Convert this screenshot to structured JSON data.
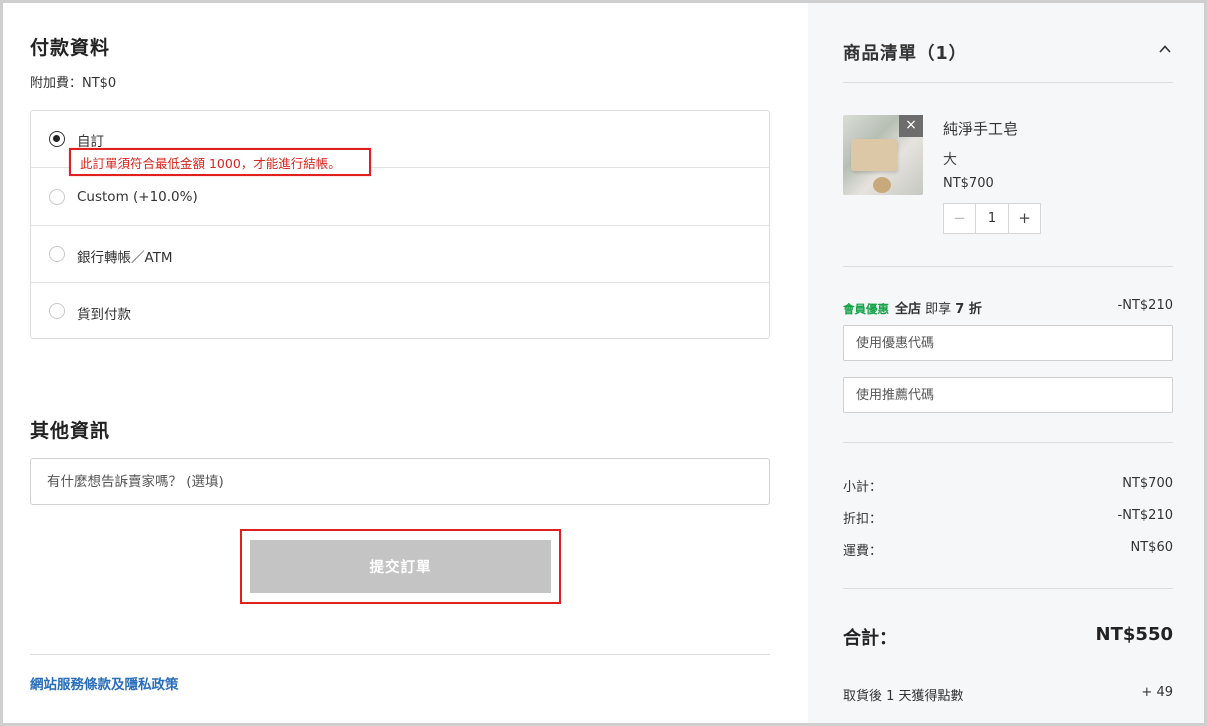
{
  "payment": {
    "title": "付款資料",
    "surcharge": "附加費：NT$0",
    "options": [
      {
        "label": "自訂",
        "selected": true
      },
      {
        "label": "Custom (+10.0%)",
        "selected": false
      },
      {
        "label": "銀行轉帳／ATM",
        "selected": false
      },
      {
        "label": "貨到付款",
        "selected": false
      }
    ],
    "warning": "此訂單須符合最低金額 1000，才能進行結帳。"
  },
  "other": {
    "title": "其他資訊",
    "note_placeholder": "有什麼想告訴賣家嗎？ (選填)"
  },
  "submit_label": "提交訂單",
  "policy_link": "網站服務條款及隱私政策",
  "cart": {
    "title": "商品清單（1）",
    "item": {
      "name": "純淨手工皂",
      "variant": "大",
      "price": "NT$700",
      "quantity": "1",
      "minus": "−",
      "plus": "+",
      "remove": "×"
    },
    "promo": {
      "tag": "會員優惠",
      "store": "全店",
      "text": " 即享 ",
      "discount": "7 折",
      "amount": "-NT$210"
    },
    "coupon_placeholder": "使用優惠代碼",
    "referral_placeholder": "使用推薦代碼",
    "subtotal_label": "小計：",
    "subtotal": "NT$700",
    "discount_label": "折扣：",
    "discount": "-NT$210",
    "shipping_label": "運費：",
    "shipping": "NT$60",
    "total_label": "合計：",
    "total": "NT$550",
    "points_label": "取貨後 1 天獲得點數",
    "points": "+ 49"
  },
  "colors": {
    "warning": "#d9251d",
    "highlight_border": "#e0201e",
    "link": "#2a6ebb",
    "promo_tag": "#17a34a",
    "submit_disabled": "#c4c4c4"
  }
}
